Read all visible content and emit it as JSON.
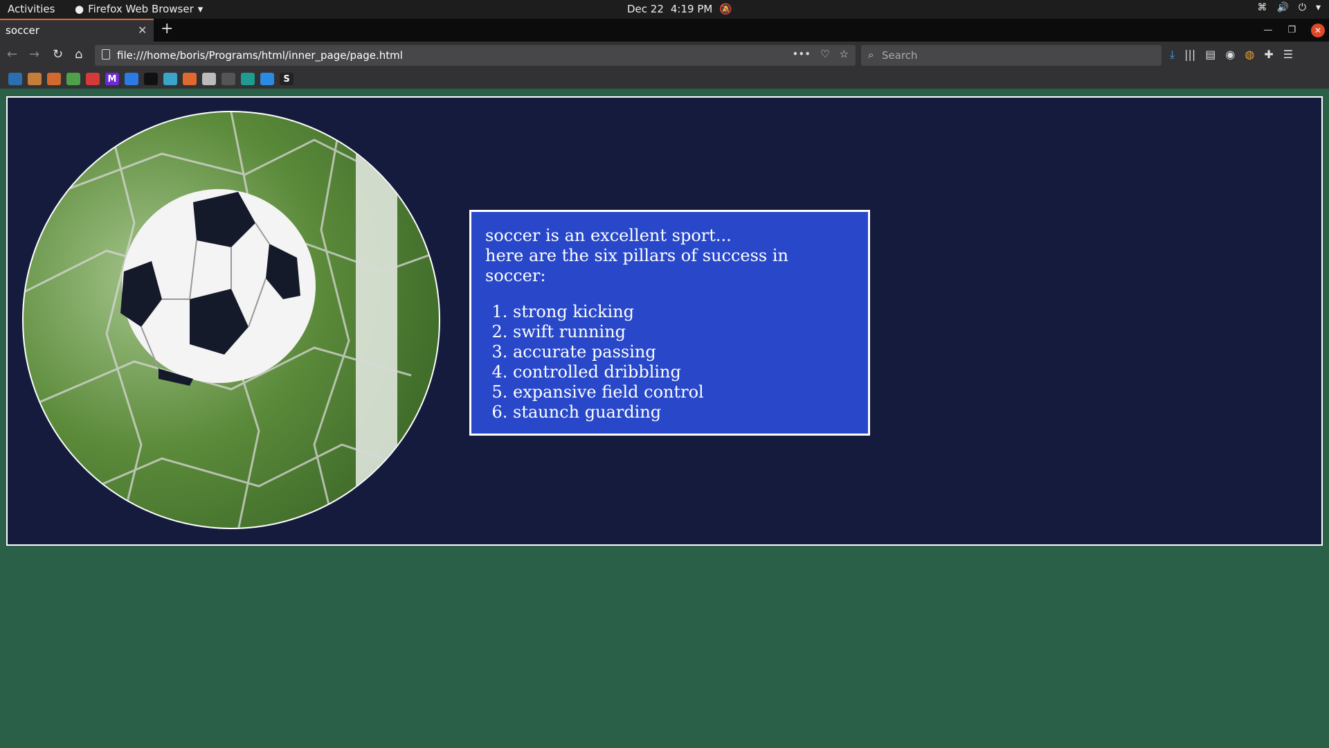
{
  "topbar": {
    "activities": "Activities",
    "app_name": "Firefox Web Browser",
    "date": "Dec 22",
    "time": "4:19 PM"
  },
  "tab": {
    "title": "soccer"
  },
  "nav": {
    "url": "file:///home/boris/Programs/html/inner_page/page.html",
    "search_placeholder": "Search"
  },
  "bookmarks": [
    {
      "icon": "bookmark-1",
      "glyph": "",
      "color": "#2b6fb0"
    },
    {
      "icon": "bookmark-2",
      "glyph": "",
      "color": "#c77d3a"
    },
    {
      "icon": "bookmark-3",
      "glyph": "",
      "color": "#d2692f"
    },
    {
      "icon": "bookmark-4",
      "glyph": "",
      "color": "#4fa04a"
    },
    {
      "icon": "bookmark-5",
      "glyph": "",
      "color": "#d43a3a"
    },
    {
      "icon": "bookmark-m",
      "glyph": "M",
      "color": "#6d2bd6"
    },
    {
      "icon": "bookmark-7",
      "glyph": "",
      "color": "#2c7be5"
    },
    {
      "icon": "github-icon",
      "glyph": "",
      "color": "#111"
    },
    {
      "icon": "bookmark-9",
      "glyph": "",
      "color": "#3aa5c9"
    },
    {
      "icon": "bookmark-10",
      "glyph": "",
      "color": "#e0692f"
    },
    {
      "icon": "bookmark-11",
      "glyph": "",
      "color": "#bbb"
    },
    {
      "icon": "bookmark-12",
      "glyph": "",
      "color": "#555"
    },
    {
      "icon": "bookmark-13",
      "glyph": "",
      "color": "#1f9b8f"
    },
    {
      "icon": "bookmark-14",
      "glyph": "",
      "color": "#2b8be0"
    },
    {
      "icon": "bookmark-s",
      "glyph": "S",
      "color": "#222"
    }
  ],
  "content": {
    "intro_line1": "soccer is an excellent sport...",
    "intro_line2": "here are the six pillars of success in soccer:",
    "pillars": [
      "strong kicking",
      "swift running",
      "accurate passing",
      "controlled dribbling",
      "expansive field control",
      "staunch guarding"
    ]
  },
  "colors": {
    "page_bg": "#2a5f48",
    "panel_bg": "#141b3d",
    "textbox_bg": "#2848c9",
    "tab_accent": "#e26a2c"
  }
}
